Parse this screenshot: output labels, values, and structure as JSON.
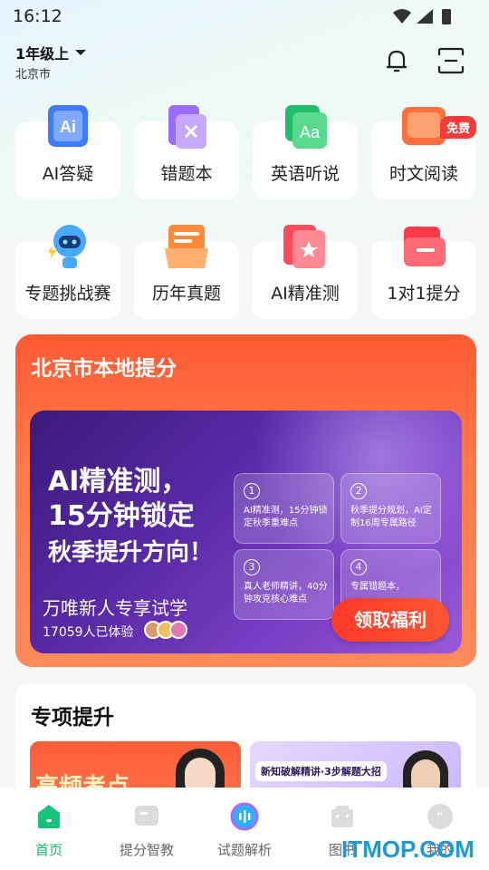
{
  "status": {
    "time": "16:12"
  },
  "header": {
    "grade": "1年级上",
    "city": "北京市",
    "bell_icon": "bell-icon",
    "scan_icon": "scan-icon"
  },
  "grid": [
    {
      "label": "AI答疑",
      "icon": "ai-answer-icon",
      "color": "#3f7bff"
    },
    {
      "label": "错题本",
      "icon": "mistake-book-icon",
      "color": "#9a6bff"
    },
    {
      "label": "英语听说",
      "icon": "english-listening-icon",
      "color": "#1fbf6a"
    },
    {
      "label": "时文阅读",
      "icon": "reading-icon",
      "color": "#ff6f3a",
      "badge": "免费"
    },
    {
      "label": "专题挑战赛",
      "icon": "robot-icon",
      "color": "#4aa8ff"
    },
    {
      "label": "历年真题",
      "icon": "past-papers-icon",
      "color": "#ff8a3a"
    },
    {
      "label": "AI精准测",
      "icon": "precise-test-icon",
      "color": "#ff4a5a"
    },
    {
      "label": "1对1提分",
      "icon": "wallet-icon",
      "color": "#ff3a48"
    }
  ],
  "local": {
    "title": "北京市本地提分",
    "headline1": "AI精准测，",
    "headline2": "15分钟锁定",
    "headline3": "秋季提升方向！",
    "promo": "万唯新人专享试学",
    "experienced": "17059人已体验",
    "steps": [
      {
        "num": "1",
        "text": "AI精准测，15分钟锁定秋季重难点"
      },
      {
        "num": "2",
        "text": "秋季提分规划，AI定制16周专属路径"
      },
      {
        "num": "3",
        "text": "真人老师精讲，40分钟攻克核心难点"
      },
      {
        "num": "4",
        "text": "专属错题本，"
      }
    ],
    "cta": "领取福利"
  },
  "special": {
    "title": "专项提升",
    "card1_text": "高频考点",
    "card2_text": "新知破解精讲·3步解题大招"
  },
  "tabs": [
    {
      "label": "首页",
      "icon": "home-icon",
      "active": true
    },
    {
      "label": "提分智教",
      "icon": "chat-icon",
      "active": false
    },
    {
      "label": "试题解析",
      "icon": "ai-sphere-icon",
      "active": false
    },
    {
      "label": "图书",
      "icon": "book-icon",
      "active": false
    },
    {
      "label": "我的",
      "icon": "profile-icon",
      "active": false
    }
  ],
  "watermark": "ITMOP.COM"
}
